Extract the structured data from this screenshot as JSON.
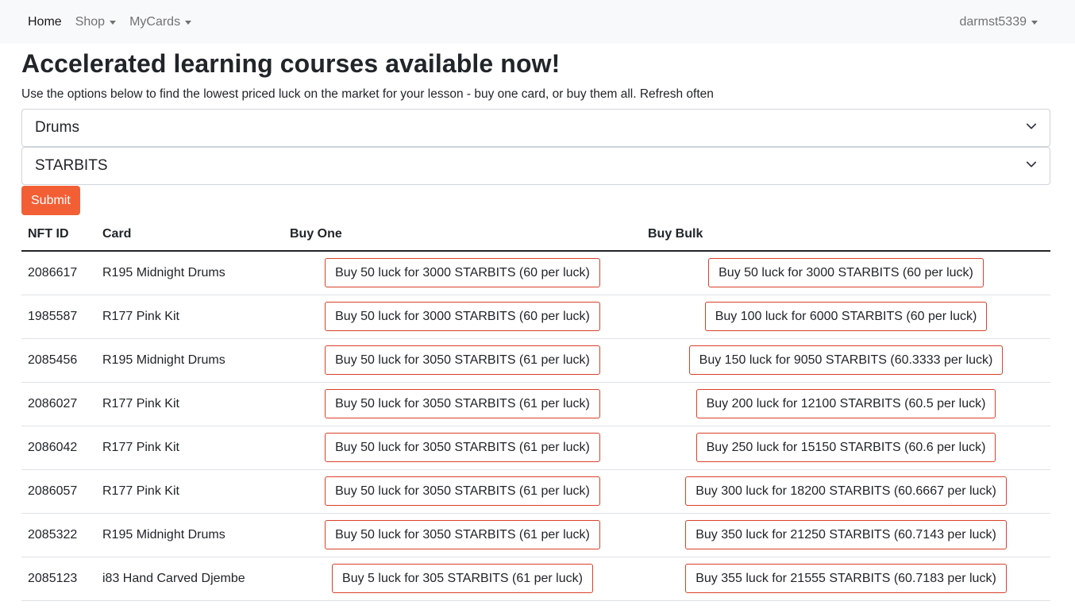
{
  "nav": {
    "home": "Home",
    "shop": "Shop",
    "mycards": "MyCards",
    "user": "darmst5339"
  },
  "page": {
    "title": "Accelerated learning courses available now!",
    "subtitle": "Use the options below to find the lowest priced luck on the market for your lesson - buy one card, or buy them all. Refresh often",
    "lesson_select": "Drums",
    "currency_select": "STARBITS",
    "submit_label": "Submit"
  },
  "table": {
    "headers": [
      "NFT ID",
      "Card",
      "Buy One",
      "Buy Bulk"
    ],
    "rows": [
      {
        "id": "2086617",
        "card": "R195 Midnight Drums",
        "buy_one": "Buy 50 luck for 3000 STARBITS (60 per luck)",
        "buy_bulk": "Buy 50 luck for 3000 STARBITS (60 per luck)"
      },
      {
        "id": "1985587",
        "card": "R177 Pink Kit",
        "buy_one": "Buy 50 luck for 3000 STARBITS (60 per luck)",
        "buy_bulk": "Buy 100 luck for 6000 STARBITS (60 per luck)"
      },
      {
        "id": "2085456",
        "card": "R195 Midnight Drums",
        "buy_one": "Buy 50 luck for 3050 STARBITS (61 per luck)",
        "buy_bulk": "Buy 150 luck for 9050 STARBITS (60.3333 per luck)"
      },
      {
        "id": "2086027",
        "card": "R177 Pink Kit",
        "buy_one": "Buy 50 luck for 3050 STARBITS (61 per luck)",
        "buy_bulk": "Buy 200 luck for 12100 STARBITS (60.5 per luck)"
      },
      {
        "id": "2086042",
        "card": "R177 Pink Kit",
        "buy_one": "Buy 50 luck for 3050 STARBITS (61 per luck)",
        "buy_bulk": "Buy 250 luck for 15150 STARBITS (60.6 per luck)"
      },
      {
        "id": "2086057",
        "card": "R177 Pink Kit",
        "buy_one": "Buy 50 luck for 3050 STARBITS (61 per luck)",
        "buy_bulk": "Buy 300 luck for 18200 STARBITS (60.6667 per luck)"
      },
      {
        "id": "2085322",
        "card": "R195 Midnight Drums",
        "buy_one": "Buy 50 luck for 3050 STARBITS (61 per luck)",
        "buy_bulk": "Buy 350 luck for 21250 STARBITS (60.7143 per luck)"
      },
      {
        "id": "2085123",
        "card": "i83 Hand Carved Djembe",
        "buy_one": "Buy 5 luck for 305 STARBITS (61 per luck)",
        "buy_bulk": "Buy 355 luck for 21555 STARBITS (60.7183 per luck)"
      }
    ]
  },
  "colors": {
    "navbar_bg": "#f8f9fa",
    "accent": "#f35f35",
    "button_border": "#d9402a"
  },
  "icons": {
    "dropdown_caret": "caret-down-icon",
    "select_chevron": "chevron-down-icon"
  }
}
